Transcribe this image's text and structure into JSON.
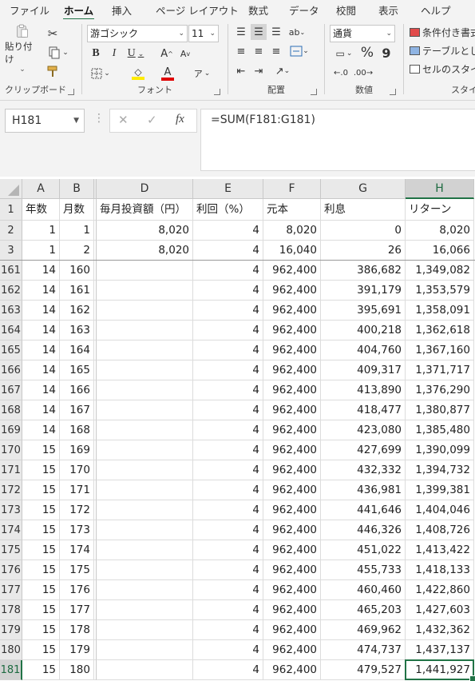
{
  "tabs": [
    "ファイル",
    "ホーム",
    "挿入",
    "ページ レイアウト",
    "数式",
    "データ",
    "校閲",
    "表示",
    "ヘルプ"
  ],
  "active_tab": "ホーム",
  "ribbon": {
    "clipboard": {
      "label": "クリップボード",
      "paste_label": "貼り付け"
    },
    "font": {
      "label": "フォント",
      "font_name": "游ゴシック",
      "font_size": "11"
    },
    "alignment": {
      "label": "配置"
    },
    "number": {
      "label": "数値",
      "format": "通貨",
      "percent": "%",
      "comma": "9"
    },
    "styles": {
      "label": "スタイ",
      "conditional": "条件付き書式",
      "as_table": "テーブルとして",
      "cell_styles": "セルのスタイル"
    }
  },
  "formula_bar": {
    "name_box": "H181",
    "formula": "=SUM(F181:G181)",
    "fx": "fx"
  },
  "columns": [
    "A",
    "B",
    "C",
    "D",
    "E",
    "F",
    "G",
    "H"
  ],
  "selected_column": "H",
  "selected_row": "181",
  "rows": [
    {
      "r": "1",
      "c": [
        "年数",
        "月数",
        "",
        "毎月投資額（円）",
        "利回（%）",
        "元本",
        "利息",
        "リターン"
      ]
    },
    {
      "r": "2",
      "c": [
        "1",
        "1",
        "",
        "8,020",
        "4",
        "8,020",
        "0",
        "8,020"
      ]
    },
    {
      "r": "3",
      "c": [
        "1",
        "2",
        "",
        "8,020",
        "4",
        "16,040",
        "26",
        "16,066"
      ]
    },
    {
      "r": "161",
      "c": [
        "14",
        "160",
        "",
        "",
        "4",
        "962,400",
        "386,682",
        "1,349,082"
      ]
    },
    {
      "r": "162",
      "c": [
        "14",
        "161",
        "",
        "",
        "4",
        "962,400",
        "391,179",
        "1,353,579"
      ]
    },
    {
      "r": "163",
      "c": [
        "14",
        "162",
        "",
        "",
        "4",
        "962,400",
        "395,691",
        "1,358,091"
      ]
    },
    {
      "r": "164",
      "c": [
        "14",
        "163",
        "",
        "",
        "4",
        "962,400",
        "400,218",
        "1,362,618"
      ]
    },
    {
      "r": "165",
      "c": [
        "14",
        "164",
        "",
        "",
        "4",
        "962,400",
        "404,760",
        "1,367,160"
      ]
    },
    {
      "r": "166",
      "c": [
        "14",
        "165",
        "",
        "",
        "4",
        "962,400",
        "409,317",
        "1,371,717"
      ]
    },
    {
      "r": "167",
      "c": [
        "14",
        "166",
        "",
        "",
        "4",
        "962,400",
        "413,890",
        "1,376,290"
      ]
    },
    {
      "r": "168",
      "c": [
        "14",
        "167",
        "",
        "",
        "4",
        "962,400",
        "418,477",
        "1,380,877"
      ]
    },
    {
      "r": "169",
      "c": [
        "14",
        "168",
        "",
        "",
        "4",
        "962,400",
        "423,080",
        "1,385,480"
      ]
    },
    {
      "r": "170",
      "c": [
        "15",
        "169",
        "",
        "",
        "4",
        "962,400",
        "427,699",
        "1,390,099"
      ]
    },
    {
      "r": "171",
      "c": [
        "15",
        "170",
        "",
        "",
        "4",
        "962,400",
        "432,332",
        "1,394,732"
      ]
    },
    {
      "r": "172",
      "c": [
        "15",
        "171",
        "",
        "",
        "4",
        "962,400",
        "436,981",
        "1,399,381"
      ]
    },
    {
      "r": "173",
      "c": [
        "15",
        "172",
        "",
        "",
        "4",
        "962,400",
        "441,646",
        "1,404,046"
      ]
    },
    {
      "r": "174",
      "c": [
        "15",
        "173",
        "",
        "",
        "4",
        "962,400",
        "446,326",
        "1,408,726"
      ]
    },
    {
      "r": "175",
      "c": [
        "15",
        "174",
        "",
        "",
        "4",
        "962,400",
        "451,022",
        "1,413,422"
      ]
    },
    {
      "r": "176",
      "c": [
        "15",
        "175",
        "",
        "",
        "4",
        "962,400",
        "455,733",
        "1,418,133"
      ]
    },
    {
      "r": "177",
      "c": [
        "15",
        "176",
        "",
        "",
        "4",
        "962,400",
        "460,460",
        "1,422,860"
      ]
    },
    {
      "r": "178",
      "c": [
        "15",
        "177",
        "",
        "",
        "4",
        "962,400",
        "465,203",
        "1,427,603"
      ]
    },
    {
      "r": "179",
      "c": [
        "15",
        "178",
        "",
        "",
        "4",
        "962,400",
        "469,962",
        "1,432,362"
      ]
    },
    {
      "r": "180",
      "c": [
        "15",
        "179",
        "",
        "",
        "4",
        "962,400",
        "474,737",
        "1,437,137"
      ]
    },
    {
      "r": "181",
      "c": [
        "15",
        "180",
        "",
        "",
        "4",
        "962,400",
        "479,527",
        "1,441,927"
      ]
    }
  ],
  "colors": {
    "accent": "#217346",
    "header_bg": "#e9e9e9",
    "selected_header_bg": "#d2d2d2"
  }
}
